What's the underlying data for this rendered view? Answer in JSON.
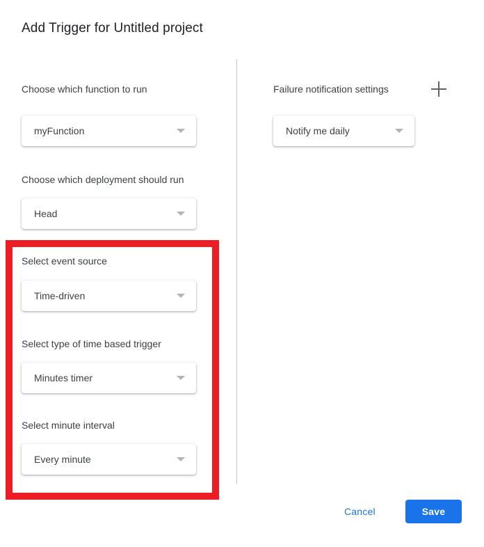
{
  "dialog": {
    "title": "Add Trigger for Untitled project"
  },
  "left_column": {
    "fields": [
      {
        "label": "Choose which function to run",
        "value": "myFunction",
        "caret_icon": "chevron-down-icon"
      },
      {
        "label": "Choose which deployment should run",
        "value": "Head",
        "caret_icon": "chevron-down-icon"
      },
      {
        "label": "Select event source",
        "value": "Time-driven",
        "caret_icon": "chevron-down-icon"
      },
      {
        "label": "Select type of time based trigger",
        "value": "Minutes timer",
        "caret_icon": "chevron-down-icon"
      },
      {
        "label": "Select minute interval",
        "value": "Every minute",
        "caret_icon": "chevron-down-icon"
      }
    ]
  },
  "right_column": {
    "label": "Failure notification settings",
    "add_icon": "plus-icon",
    "notification": {
      "value": "Notify me daily",
      "caret_icon": "chevron-down-icon"
    }
  },
  "footer": {
    "cancel_label": "Cancel",
    "save_label": "Save"
  },
  "annotation": {
    "type": "red-rectangle-highlight",
    "color": "#ee1c24",
    "covers": [
      "Select event source",
      "Select type of time based trigger",
      "Select minute interval"
    ]
  },
  "colors": {
    "accent_blue": "#1a73e8",
    "text_primary": "#202124",
    "text_secondary": "#3c4043",
    "caret_gray": "#b3b3b3",
    "divider": "#c4c4ce",
    "annotation_red": "#ee1c24"
  }
}
